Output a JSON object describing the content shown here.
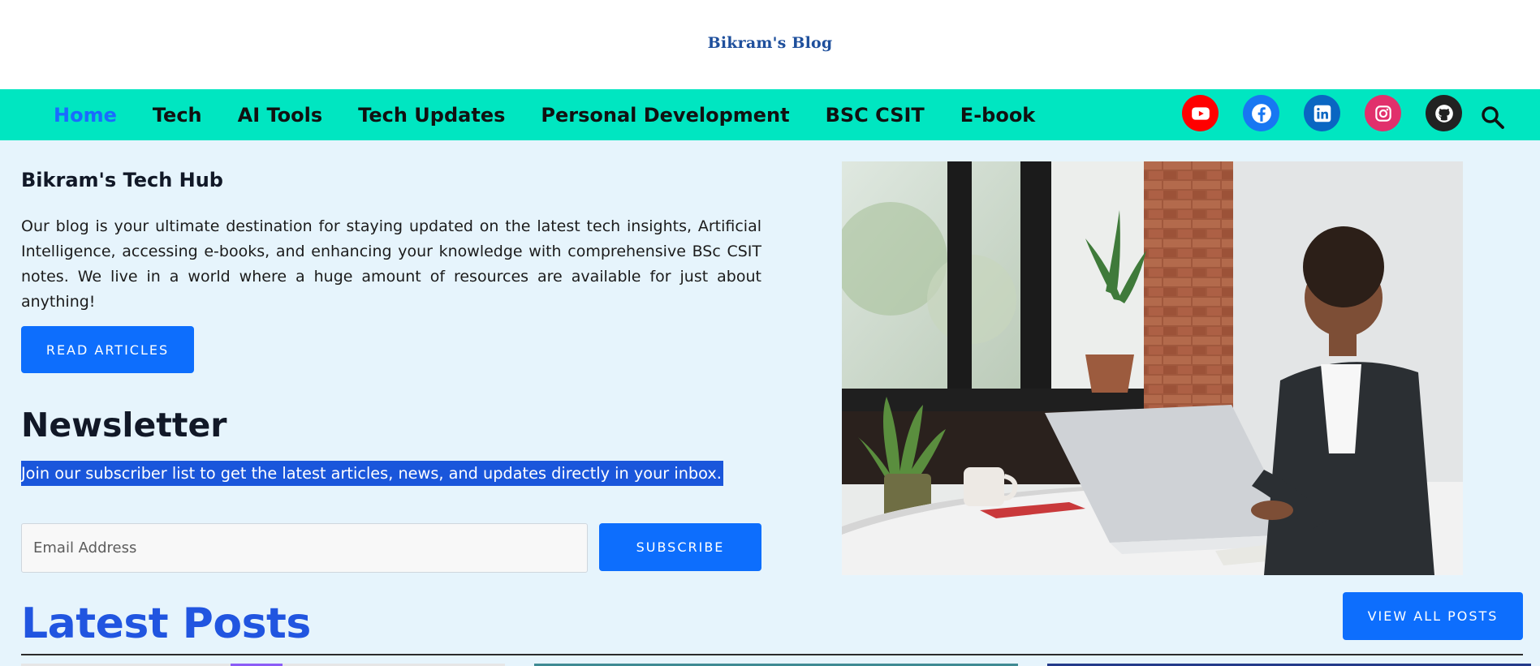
{
  "site": {
    "logo_text": "Bikram's Blog"
  },
  "nav": {
    "items": [
      {
        "label": "Home",
        "active": true
      },
      {
        "label": "Tech"
      },
      {
        "label": "AI Tools"
      },
      {
        "label": "Tech Updates"
      },
      {
        "label": "Personal Development"
      },
      {
        "label": "BSC CSIT"
      },
      {
        "label": "E-book"
      }
    ],
    "active_color": "#1a6bff",
    "bar_color": "#00e6c1"
  },
  "social": [
    {
      "icon": "youtube-icon",
      "color": "#ff0000"
    },
    {
      "icon": "facebook-icon",
      "color": "#1877f2"
    },
    {
      "icon": "linkedin-icon",
      "color": "#0a66c2"
    },
    {
      "icon": "instagram-icon",
      "color": "#e1306c"
    },
    {
      "icon": "github-icon",
      "color": "#222222"
    }
  ],
  "hero": {
    "title": "Bikram's Tech Hub",
    "description": "Our blog is your ultimate destination for staying updated on the latest tech insights, Artificial Intelligence, accessing e-books, and enhancing your knowledge with comprehensive BSc CSIT notes. We live in a world where a huge amount of resources are available for just about anything!",
    "button_label": "READ ARTICLES"
  },
  "newsletter": {
    "title": "Newsletter",
    "description": "Join our subscriber list to get the latest articles, news, and updates directly in your inbox.",
    "email_placeholder": "Email Address",
    "subscribe_label": "SUBSCRIBE"
  },
  "latest": {
    "title": "Latest Posts",
    "view_all_label": "VIEW ALL POSTS"
  },
  "colors": {
    "primary_button": "#0d6efd",
    "page_background": "#e6f4fc",
    "heading_blue": "#2155e0"
  }
}
